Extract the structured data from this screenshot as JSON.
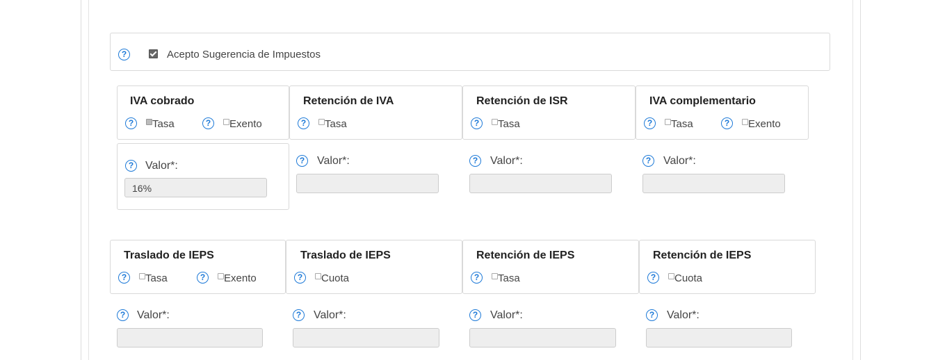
{
  "accept": {
    "label": "Acepto Sugerencia de Impuestos",
    "checked": true
  },
  "help_icon": "question-circle-icon",
  "accent": "#1e7ad8",
  "row1": [
    {
      "title": "IVA cobrado",
      "options": [
        {
          "label": "Tasa",
          "checked": true
        },
        {
          "label": "Exento",
          "checked": false
        }
      ],
      "value_label": "Valor*:",
      "value": "16%"
    },
    {
      "title": "Retención de IVA",
      "options": [
        {
          "label": "Tasa",
          "checked": false
        }
      ],
      "value_label": "Valor*:",
      "value": ""
    },
    {
      "title": "Retención de ISR",
      "options": [
        {
          "label": "Tasa",
          "checked": false
        }
      ],
      "value_label": "Valor*:",
      "value": ""
    },
    {
      "title": "IVA complementario",
      "options": [
        {
          "label": "Tasa",
          "checked": false
        },
        {
          "label": "Exento",
          "checked": false
        }
      ],
      "value_label": "Valor*:",
      "value": ""
    }
  ],
  "row2": [
    {
      "title": "Traslado de IEPS",
      "options": [
        {
          "label": "Tasa",
          "checked": false
        },
        {
          "label": "Exento",
          "checked": false
        }
      ],
      "value_label": "Valor*:",
      "value": ""
    },
    {
      "title": "Traslado de IEPS",
      "options": [
        {
          "label": "Cuota",
          "checked": false
        }
      ],
      "value_label": "Valor*:",
      "value": ""
    },
    {
      "title": "Retención de IEPS",
      "options": [
        {
          "label": "Tasa",
          "checked": false
        }
      ],
      "value_label": "Valor*:",
      "value": ""
    },
    {
      "title": "Retención de IEPS",
      "options": [
        {
          "label": "Cuota",
          "checked": false
        }
      ],
      "value_label": "Valor*:",
      "value": ""
    }
  ]
}
